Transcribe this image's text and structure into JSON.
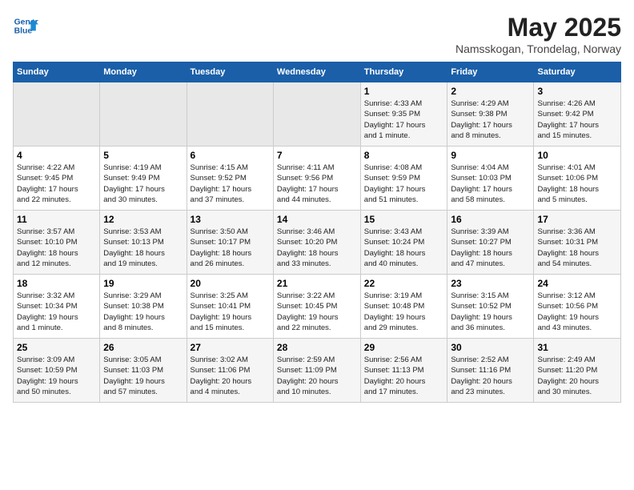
{
  "logo": {
    "name_line1": "General",
    "name_line2": "Blue"
  },
  "title": "May 2025",
  "subtitle": "Namsskogan, Trondelag, Norway",
  "days_of_week": [
    "Sunday",
    "Monday",
    "Tuesday",
    "Wednesday",
    "Thursday",
    "Friday",
    "Saturday"
  ],
  "weeks": [
    [
      {
        "day": "",
        "info": ""
      },
      {
        "day": "",
        "info": ""
      },
      {
        "day": "",
        "info": ""
      },
      {
        "day": "",
        "info": ""
      },
      {
        "day": "1",
        "info": "Sunrise: 4:33 AM\nSunset: 9:35 PM\nDaylight: 17 hours\nand 1 minute."
      },
      {
        "day": "2",
        "info": "Sunrise: 4:29 AM\nSunset: 9:38 PM\nDaylight: 17 hours\nand 8 minutes."
      },
      {
        "day": "3",
        "info": "Sunrise: 4:26 AM\nSunset: 9:42 PM\nDaylight: 17 hours\nand 15 minutes."
      }
    ],
    [
      {
        "day": "4",
        "info": "Sunrise: 4:22 AM\nSunset: 9:45 PM\nDaylight: 17 hours\nand 22 minutes."
      },
      {
        "day": "5",
        "info": "Sunrise: 4:19 AM\nSunset: 9:49 PM\nDaylight: 17 hours\nand 30 minutes."
      },
      {
        "day": "6",
        "info": "Sunrise: 4:15 AM\nSunset: 9:52 PM\nDaylight: 17 hours\nand 37 minutes."
      },
      {
        "day": "7",
        "info": "Sunrise: 4:11 AM\nSunset: 9:56 PM\nDaylight: 17 hours\nand 44 minutes."
      },
      {
        "day": "8",
        "info": "Sunrise: 4:08 AM\nSunset: 9:59 PM\nDaylight: 17 hours\nand 51 minutes."
      },
      {
        "day": "9",
        "info": "Sunrise: 4:04 AM\nSunset: 10:03 PM\nDaylight: 17 hours\nand 58 minutes."
      },
      {
        "day": "10",
        "info": "Sunrise: 4:01 AM\nSunset: 10:06 PM\nDaylight: 18 hours\nand 5 minutes."
      }
    ],
    [
      {
        "day": "11",
        "info": "Sunrise: 3:57 AM\nSunset: 10:10 PM\nDaylight: 18 hours\nand 12 minutes."
      },
      {
        "day": "12",
        "info": "Sunrise: 3:53 AM\nSunset: 10:13 PM\nDaylight: 18 hours\nand 19 minutes."
      },
      {
        "day": "13",
        "info": "Sunrise: 3:50 AM\nSunset: 10:17 PM\nDaylight: 18 hours\nand 26 minutes."
      },
      {
        "day": "14",
        "info": "Sunrise: 3:46 AM\nSunset: 10:20 PM\nDaylight: 18 hours\nand 33 minutes."
      },
      {
        "day": "15",
        "info": "Sunrise: 3:43 AM\nSunset: 10:24 PM\nDaylight: 18 hours\nand 40 minutes."
      },
      {
        "day": "16",
        "info": "Sunrise: 3:39 AM\nSunset: 10:27 PM\nDaylight: 18 hours\nand 47 minutes."
      },
      {
        "day": "17",
        "info": "Sunrise: 3:36 AM\nSunset: 10:31 PM\nDaylight: 18 hours\nand 54 minutes."
      }
    ],
    [
      {
        "day": "18",
        "info": "Sunrise: 3:32 AM\nSunset: 10:34 PM\nDaylight: 19 hours\nand 1 minute."
      },
      {
        "day": "19",
        "info": "Sunrise: 3:29 AM\nSunset: 10:38 PM\nDaylight: 19 hours\nand 8 minutes."
      },
      {
        "day": "20",
        "info": "Sunrise: 3:25 AM\nSunset: 10:41 PM\nDaylight: 19 hours\nand 15 minutes."
      },
      {
        "day": "21",
        "info": "Sunrise: 3:22 AM\nSunset: 10:45 PM\nDaylight: 19 hours\nand 22 minutes."
      },
      {
        "day": "22",
        "info": "Sunrise: 3:19 AM\nSunset: 10:48 PM\nDaylight: 19 hours\nand 29 minutes."
      },
      {
        "day": "23",
        "info": "Sunrise: 3:15 AM\nSunset: 10:52 PM\nDaylight: 19 hours\nand 36 minutes."
      },
      {
        "day": "24",
        "info": "Sunrise: 3:12 AM\nSunset: 10:56 PM\nDaylight: 19 hours\nand 43 minutes."
      }
    ],
    [
      {
        "day": "25",
        "info": "Sunrise: 3:09 AM\nSunset: 10:59 PM\nDaylight: 19 hours\nand 50 minutes."
      },
      {
        "day": "26",
        "info": "Sunrise: 3:05 AM\nSunset: 11:03 PM\nDaylight: 19 hours\nand 57 minutes."
      },
      {
        "day": "27",
        "info": "Sunrise: 3:02 AM\nSunset: 11:06 PM\nDaylight: 20 hours\nand 4 minutes."
      },
      {
        "day": "28",
        "info": "Sunrise: 2:59 AM\nSunset: 11:09 PM\nDaylight: 20 hours\nand 10 minutes."
      },
      {
        "day": "29",
        "info": "Sunrise: 2:56 AM\nSunset: 11:13 PM\nDaylight: 20 hours\nand 17 minutes."
      },
      {
        "day": "30",
        "info": "Sunrise: 2:52 AM\nSunset: 11:16 PM\nDaylight: 20 hours\nand 23 minutes."
      },
      {
        "day": "31",
        "info": "Sunrise: 2:49 AM\nSunset: 11:20 PM\nDaylight: 20 hours\nand 30 minutes."
      }
    ]
  ]
}
